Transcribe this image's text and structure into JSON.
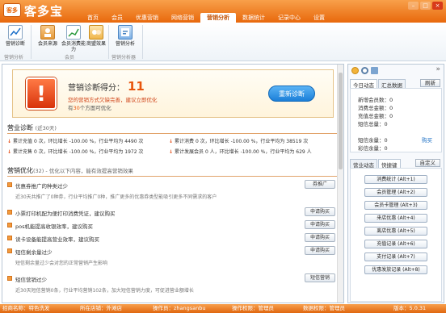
{
  "app": {
    "logo_badge": "客多",
    "logo_text": "客多宝",
    "nav": [
      "首页",
      "会员",
      "优惠营销",
      "网络营销",
      "营销分析",
      "数据统计",
      "记录中心",
      "设置"
    ],
    "active_nav": "营销分析"
  },
  "toolbar": {
    "tools": [
      {
        "label": "营销诊断",
        "icon": "line-chart-icon"
      },
      {
        "label": "会员来源",
        "icon": "member-source-icon"
      },
      {
        "label": "会员消费能力",
        "icon": "member-consumption-icon"
      },
      {
        "label": "商盟效果",
        "icon": "alliance-effect-icon"
      },
      {
        "label": "营销分析",
        "icon": "marketing-analysis-icon"
      }
    ],
    "groups": [
      "营销分析",
      "会员",
      "营销分析器"
    ]
  },
  "score": {
    "title": "营销诊断得分：",
    "value": "11",
    "desc": "您的营销方式欠缺完善，建议立即优化",
    "sub_prefix": "有",
    "sub_count": "30",
    "sub_suffix": "个方面可优化",
    "button": "重新诊断"
  },
  "diagnosis": {
    "title": "营业诊断",
    "period": "(近30天)",
    "items": [
      "累计充值 0 次，环比增长 -100.00 %，行业平均为 4490 次",
      "累计消费 0 次，环比增长 -100.00 %，行业平均为 38519 次",
      "累计充售 0 次，环比增长 -100.00 %，行业平均为 1972 次",
      "累计发展会员 0 人，环比增长 -100.00 %，行业平均为 629 人"
    ]
  },
  "optimization": {
    "title": "营销优化",
    "count": "(32)",
    "hint": " - 优化以下内容，能有效提高营销效果",
    "rows": [
      {
        "text": "优惠券推广的种类过少",
        "sub": "近30天共推广了0种券，行业平均推广0种，推广更多的优惠券类型能吸引更多不同需求的客户",
        "button": "券推广"
      },
      {
        "text": "小票打印机配为便打印消费凭证，建议购买",
        "sub": "",
        "button": "申请购买"
      },
      {
        "text": "pos机能提高收银效率，建议购买",
        "sub": "",
        "button": "申请购买"
      },
      {
        "text": "读卡设备能提高营业效率，建议购买",
        "sub": "",
        "button": "申请购买"
      },
      {
        "text": "短信剩余量过少",
        "sub": "短信剩余量过少会对您的正常营销产生影响",
        "button": "申请购买"
      },
      {
        "text": "短信营销过少",
        "sub": "近30天短信营销0条，行业平均营销102条，加大短信营销力度，可促进营业额增长",
        "button": "短信营销"
      }
    ]
  },
  "right_panel": {
    "tabs": [
      "今日动态",
      "汇总数据"
    ],
    "refresh": "刷新",
    "stats": [
      "新增会员数：0",
      "消费总金额：0",
      "充值总金额：0",
      "短信总量：0"
    ],
    "sms": [
      "短信余量：0",
      "彩信余量：0"
    ],
    "buy": "购买",
    "tabs2": [
      "营业动态",
      "快捷键"
    ],
    "custom": "自定义",
    "hotkeys": [
      "消费统计 (Alt+1)",
      "会员管理 (Alt+2)",
      "会员卡管理 (Alt+3)",
      "来店优惠 (Alt+4)",
      "离店优惠 (Alt+5)",
      "充值记录 (Alt+6)",
      "支付记录 (Alt+7)",
      "优惠发放记录 (Alt+8)"
    ]
  },
  "status": {
    "org": "招商名称：特色洗发",
    "store": "所在店铺：外滩店",
    "operator": "操作员：zhangsanbu",
    "permission": "操作权限：管理员",
    "data_permission": "数据权限：管理员",
    "version": "版本：5.0.31"
  }
}
